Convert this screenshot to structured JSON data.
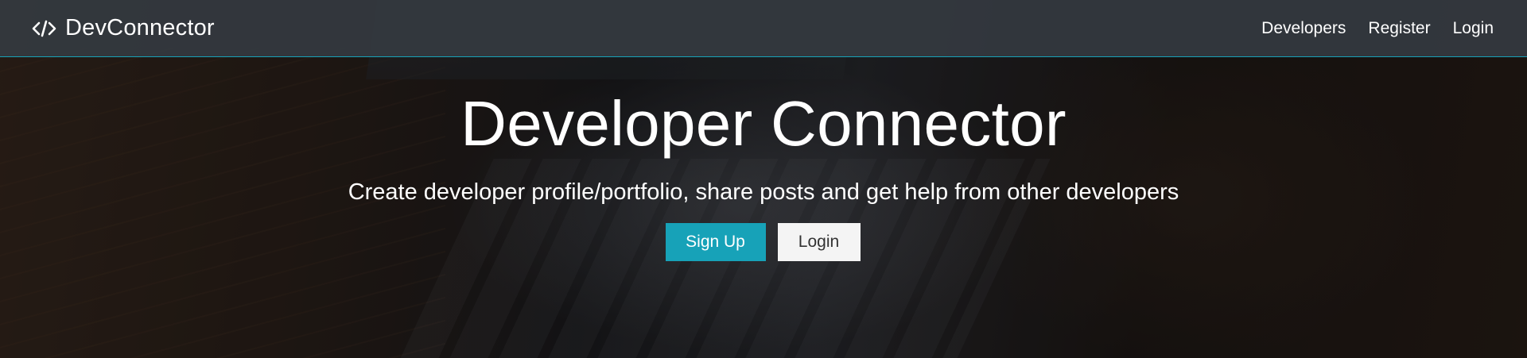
{
  "navbar": {
    "brand_icon": "code-icon",
    "brand_text": "DevConnector",
    "links": [
      {
        "label": "Developers"
      },
      {
        "label": "Register"
      },
      {
        "label": "Login"
      }
    ],
    "border_color": "#17a2b8"
  },
  "landing": {
    "title": "Developer Connector",
    "lead": "Create developer profile/portfolio, share posts and get help from other developers",
    "buttons": {
      "signup_label": "Sign Up",
      "login_label": "Login"
    },
    "accent_color": "#17a2b8"
  }
}
